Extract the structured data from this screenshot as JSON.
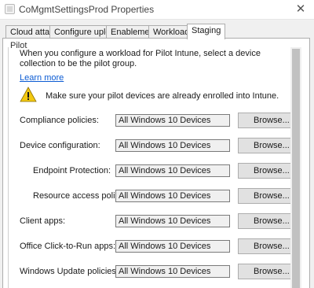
{
  "window": {
    "title": "CoMgmtSettingsProd Properties",
    "close_glyph": "✕"
  },
  "tabs": [
    {
      "label": "Cloud attach",
      "active": false
    },
    {
      "label": "Configure upload",
      "active": false
    },
    {
      "label": "Enablement",
      "active": false
    },
    {
      "label": "Workloads",
      "active": false
    },
    {
      "label": "Staging",
      "active": true
    }
  ],
  "pilot": {
    "group_label": "Pilot",
    "intro_text": "When you configure a workload for Pilot Intune, select a device collection to be the pilot group.",
    "learn_more": "Learn more",
    "warning_icon": "warning-triangle-icon",
    "warning_text": "Make sure your pilot devices are already enrolled into Intune."
  },
  "rows": [
    {
      "label": "Compliance policies:",
      "value": "All Windows 10 Devices",
      "button": "Browse... (C)"
    },
    {
      "label": "Device configuration:",
      "value": "All Windows 10 Devices",
      "button": "Browse... (D)"
    },
    {
      "label": "Endpoint Protection:",
      "value": "All Windows 10 Devices",
      "button": "Browse... (E)"
    },
    {
      "label": "Resource access policies:",
      "value": "All Windows 10 Devices",
      "button": "Browse... (R)"
    },
    {
      "label": "Client apps:",
      "value": "All Windows 10 Devices",
      "button": "Browse... (L)"
    },
    {
      "label": "Office Click-to-Run apps:",
      "value": "All Windows 10 Devices",
      "button": "Browse... (F)"
    },
    {
      "label": "Windows Update policies:",
      "value": "All Windows 10 Devices",
      "button": "Browse... (W)"
    }
  ],
  "colors": {
    "link": "#0b5bd3",
    "warning_fill": "#f2c811"
  }
}
